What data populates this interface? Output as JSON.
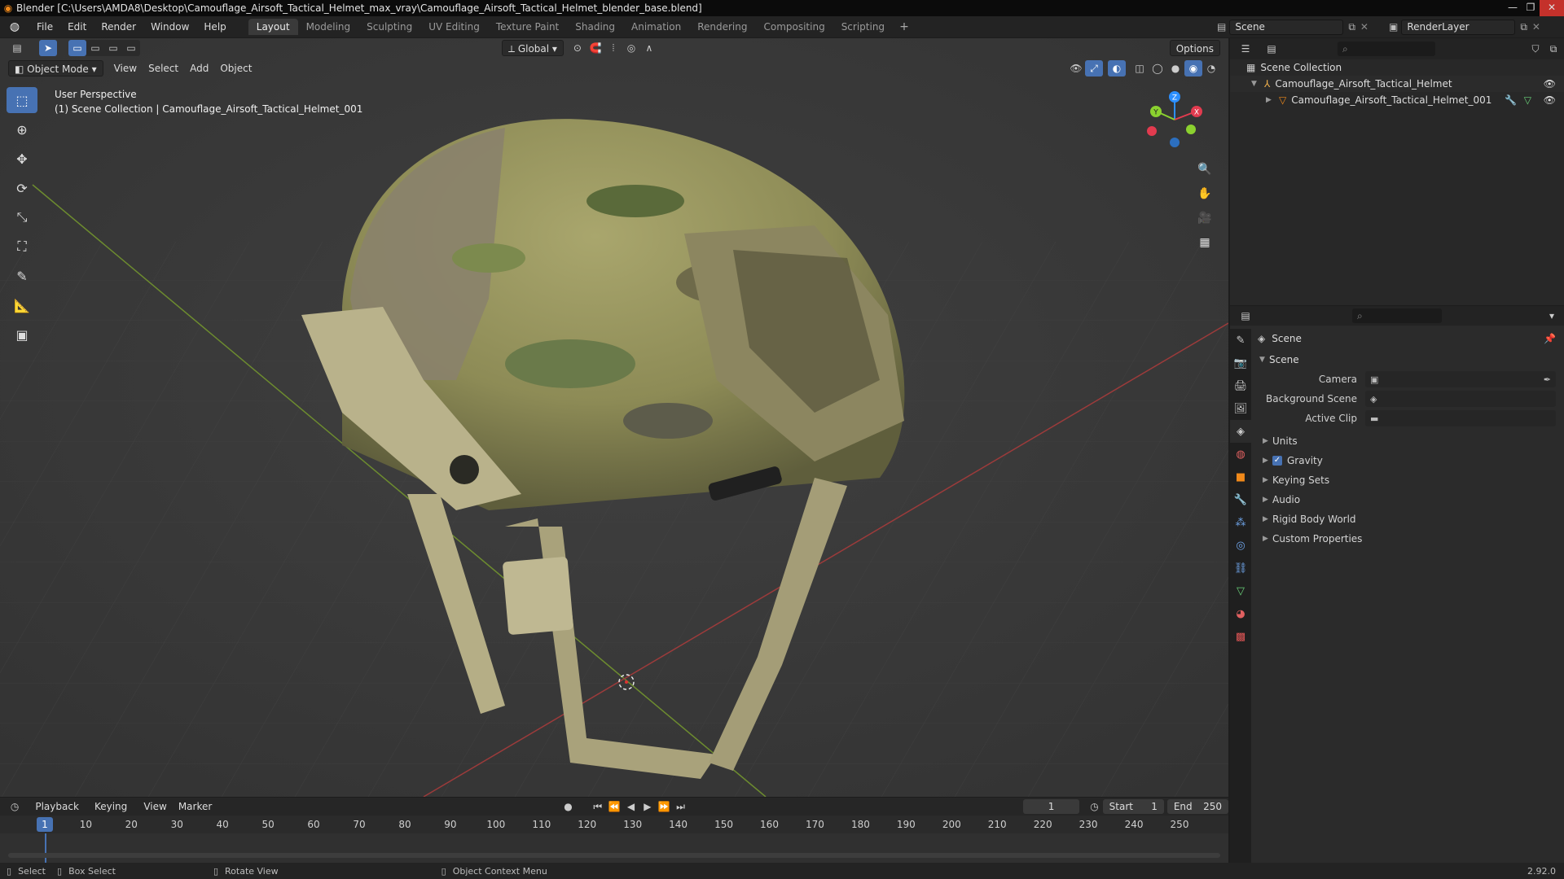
{
  "window": {
    "title": "Blender [C:\\Users\\AMDA8\\Desktop\\Camouflage_Airsoft_Tactical_Helmet_max_vray\\Camouflage_Airsoft_Tactical_Helmet_blender_base.blend]",
    "controls": [
      "—",
      "❐",
      "✕"
    ]
  },
  "menu": [
    "File",
    "Edit",
    "Render",
    "Window",
    "Help"
  ],
  "workspaces": [
    "Layout",
    "Modeling",
    "Sculpting",
    "UV Editing",
    "Texture Paint",
    "Shading",
    "Animation",
    "Rendering",
    "Compositing",
    "Scripting"
  ],
  "workspace_add": "+",
  "scene_name": "Scene",
  "render_layer": "RenderLayer",
  "viewport": {
    "orientation": "Global",
    "options": "Options",
    "mode": "Object Mode",
    "menus": [
      "View",
      "Select",
      "Add",
      "Object"
    ],
    "info_line1": "User Perspective",
    "info_line2": "(1) Scene Collection | Camouflage_Airsoft_Tactical_Helmet_001",
    "gizmo_labels": {
      "z": "Z",
      "y": "Y",
      "x": "X"
    }
  },
  "outliner": {
    "root": "Scene Collection",
    "collection": "Camouflage_Airsoft_Tactical_Helmet",
    "object": "Camouflage_Airsoft_Tactical_Helmet_001"
  },
  "properties": {
    "header": "Scene",
    "section": "Scene",
    "fields": [
      {
        "label": "Camera",
        "value": ""
      },
      {
        "label": "Background Scene",
        "value": ""
      },
      {
        "label": "Active Clip",
        "value": ""
      }
    ],
    "subpanels": [
      {
        "label": "Units",
        "checkbox": false
      },
      {
        "label": "Gravity",
        "checkbox": true
      },
      {
        "label": "Keying Sets",
        "checkbox": false
      },
      {
        "label": "Audio",
        "checkbox": false
      },
      {
        "label": "Rigid Body World",
        "checkbox": false
      },
      {
        "label": "Custom Properties",
        "checkbox": false
      }
    ]
  },
  "timeline": {
    "menus": [
      "Playback",
      "Keying",
      "View",
      "Marker"
    ],
    "current_frame": "1",
    "start_label": "Start",
    "start": "1",
    "end_label": "End",
    "end": "250",
    "ticks": [
      "1",
      "10",
      "20",
      "30",
      "40",
      "50",
      "60",
      "70",
      "80",
      "90",
      "100",
      "110",
      "120",
      "130",
      "140",
      "150",
      "160",
      "170",
      "180",
      "190",
      "200",
      "210",
      "220",
      "230",
      "240",
      "250"
    ]
  },
  "status": {
    "select": "Select",
    "box_select": "Box Select",
    "rotate": "Rotate View",
    "context": "Object Context Menu",
    "version": "2.92.0"
  },
  "colors": {
    "accent": "#4772b3",
    "x_axis": "#e23b4f",
    "y_axis": "#8bd12f",
    "z_axis": "#2c8fff"
  }
}
